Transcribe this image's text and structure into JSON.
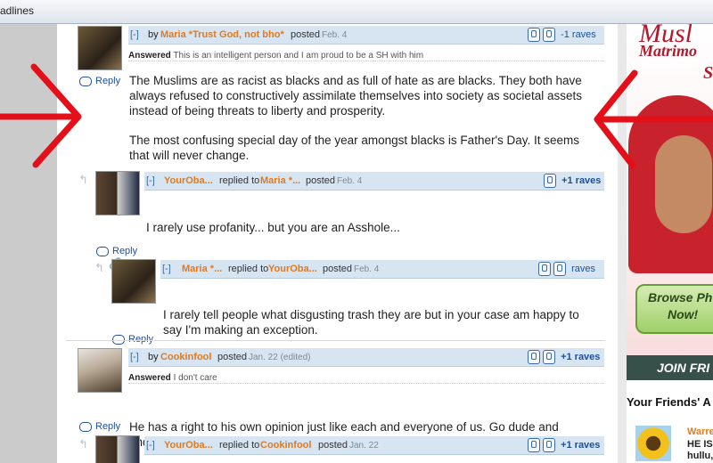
{
  "browser": {
    "tab_text": "adlines"
  },
  "comments": [
    {
      "collapse": "[-]",
      "by": "by",
      "user": "Maria *Trust God, not bho*",
      "posted_label": "posted",
      "date": "Feb. 4",
      "raves": "-1 raves",
      "answer_label": "Answered",
      "answer_text": "This is an intelligent person and I am proud to be a SH with him",
      "body1": "The Muslims are as racist as blacks and as full of hate as are blacks. They both have always refused to constructively assimilate themselves into society as societal assets instead of being threats to liberty and prosperity.",
      "body2": "The most confusing special day of the year amongst blacks is Father's Day. It seems that will never change.",
      "reply": "Reply"
    },
    {
      "collapse": "[-]",
      "user": "YourOba...",
      "replied_label": "replied to",
      "target": "Maria *...",
      "posted_label": "posted",
      "date": "Feb. 4",
      "raves": "+1 raves",
      "body": "I rarely use profanity... but you are an Asshole...",
      "reply": "Reply"
    },
    {
      "collapse": "[-]",
      "user": "Maria *...",
      "replied_label": "replied to",
      "target": "YourOba...",
      "posted_label": "posted",
      "date": "Feb. 4",
      "raves": "raves",
      "body": "I rarely tell people what disgusting trash they are but in your case am happy to say I'm making an exception.",
      "reply": "Reply"
    },
    {
      "collapse": "[-]",
      "by": "by",
      "user": "Cookinfool",
      "posted_label": "posted",
      "date": "Jan. 22 (edited)",
      "raves": "+1 raves",
      "answer_label": "Answered",
      "answer_text": "I don't care",
      "body": "He has a right to his own opinion just like each and everyone of us. Go dude and andreline, dudette for posting, Freedom of speech is incredible! GO, GO, GO",
      "reply": "Reply"
    },
    {
      "collapse": "[-]",
      "user": "YourOba...",
      "replied_label": "replied to",
      "target": "Cookinfool",
      "posted_label": "posted",
      "date": "Jan. 22",
      "raves": "+1 raves"
    }
  ],
  "sidebar": {
    "ad_title": "Musl",
    "ad_subtitle": "Matrimo",
    "ad_letter": "S",
    "browse_line1": "Browse Ph",
    "browse_line2": "Now!",
    "join": "JOIN FRI",
    "friends_heading": "Your Friends' A",
    "friend_name": "Warre",
    "friend_line1": "HE IS",
    "friend_line2": "hullu,"
  },
  "colors": {
    "username": "#e07a1f",
    "link": "#1d4f9c",
    "arrow": "#e3101a",
    "ad_red": "#b3182b"
  }
}
